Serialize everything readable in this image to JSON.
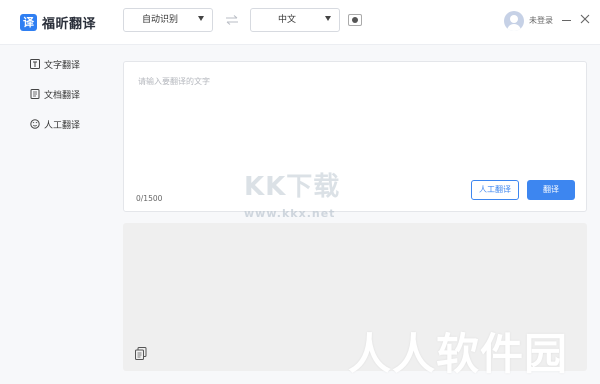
{
  "app": {
    "name": "福昕翻译",
    "logo_char": "译"
  },
  "toolbar": {
    "source_language": "自动识别",
    "target_language": "中文"
  },
  "user": {
    "login_label": "未登录"
  },
  "sidebar": {
    "items": [
      {
        "label": "文字翻译"
      },
      {
        "label": "文档翻译"
      },
      {
        "label": "人工翻译"
      }
    ]
  },
  "input": {
    "placeholder": "请输入要翻译的文字",
    "char_counter": "0/1500",
    "human_button_label": "人工翻译",
    "translate_button_label": "翻译"
  },
  "watermarks": {
    "kk_title": "KK下载",
    "kk_url": "www.kkx.net",
    "rr_title": "人人软件园"
  },
  "colors": {
    "accent": "#3d86f0",
    "brand": "#2f7ff2"
  }
}
